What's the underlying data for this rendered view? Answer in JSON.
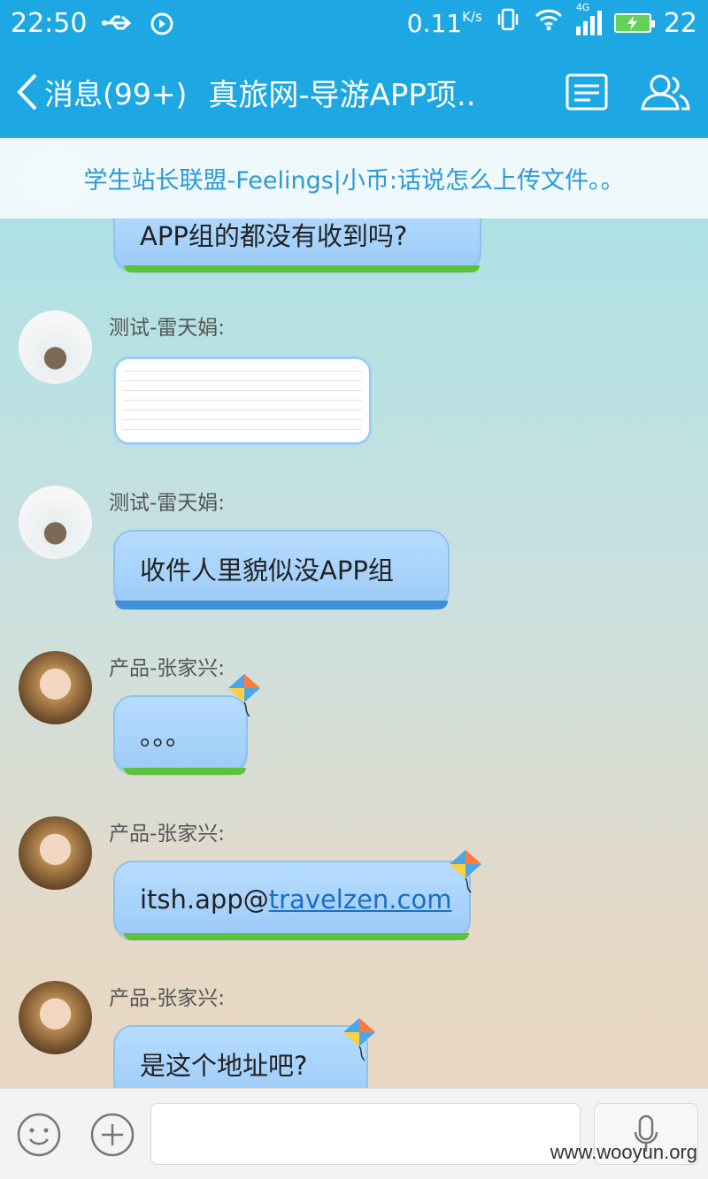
{
  "status_bar": {
    "time": "22:50",
    "net_speed": "0.11",
    "net_unit": "K/s",
    "network": "4G",
    "battery_level": "22"
  },
  "header": {
    "back_label": "消息(99+)",
    "title": "真旅网-导游APP项.."
  },
  "notice": {
    "text": "学生站长联盟-Feelings|小币:话说怎么上传文件。。"
  },
  "messages": [
    {
      "sender": "",
      "text": "APP组的都没有收到吗?"
    },
    {
      "sender": "测试-雷天娟:",
      "image_caption": "email screenshot"
    },
    {
      "sender": "测试-雷天娟:",
      "text": "收件人里貌似没APP组"
    },
    {
      "sender": "产品-张家兴:",
      "text": "。。。"
    },
    {
      "sender": "产品-张家兴:",
      "text_prefix": "itsh.app@",
      "text_link": "travelzen.com"
    },
    {
      "sender": "产品-张家兴:",
      "text": "是这个地址吧?"
    }
  ],
  "input": {
    "placeholder": ""
  },
  "watermark": "www.wooyun.org",
  "colors": {
    "accent": "#1da8e4",
    "bubble": "#9ccbf7",
    "notice_text": "#2b9bd6"
  }
}
